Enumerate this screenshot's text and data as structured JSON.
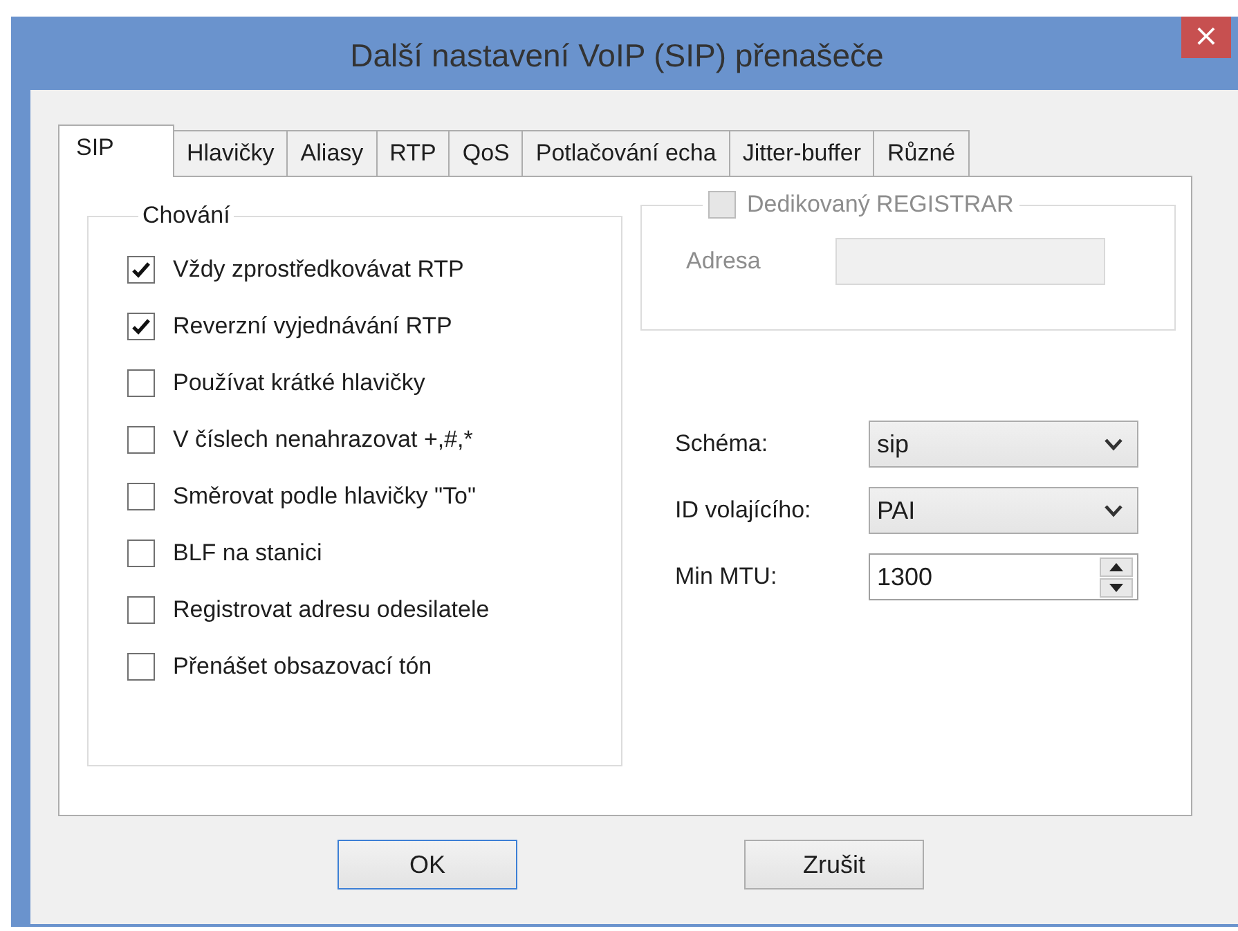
{
  "window": {
    "title": "Další nastavení VoIP (SIP) přenašeče",
    "close": "×"
  },
  "tabs": [
    {
      "label": "SIP",
      "selected": true
    },
    {
      "label": "Hlavičky",
      "selected": false
    },
    {
      "label": "Aliasy",
      "selected": false
    },
    {
      "label": "RTP",
      "selected": false
    },
    {
      "label": "QoS",
      "selected": false
    },
    {
      "label": "Potlačování echa",
      "selected": false
    },
    {
      "label": "Jitter-buffer",
      "selected": false
    },
    {
      "label": "Různé",
      "selected": false
    }
  ],
  "behavior_group": {
    "title": "Chování",
    "options": [
      {
        "label": "Vždy zprostředkovávat RTP",
        "checked": true
      },
      {
        "label": "Reverzní vyjednávání RTP",
        "checked": true
      },
      {
        "label": "Používat krátké hlavičky",
        "checked": false
      },
      {
        "label": "V číslech nenahrazovat +,#,*",
        "checked": false
      },
      {
        "label": "Směrovat podle hlavičky \"To\"",
        "checked": false
      },
      {
        "label": "BLF na stanici",
        "checked": false
      },
      {
        "label": "Registrovat adresu odesilatele",
        "checked": false
      },
      {
        "label": "Přenášet obsazovací tón",
        "checked": false
      }
    ]
  },
  "registrar_group": {
    "label": "Dedikovaný REGISTRAR",
    "checked": false,
    "disabled": true,
    "address_label": "Adresa"
  },
  "fields": [
    {
      "kind": "select",
      "label": "Schéma:",
      "value": "sip"
    },
    {
      "kind": "select",
      "label": "ID volajícího:",
      "value": "PAI"
    },
    {
      "kind": "spinner",
      "label": "Min MTU:",
      "value": "1300"
    }
  ],
  "buttons": [
    {
      "label": "OK",
      "default": true
    },
    {
      "label": "Zrušit",
      "default": false
    }
  ]
}
